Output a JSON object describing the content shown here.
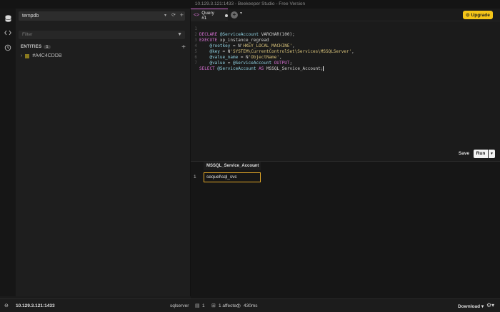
{
  "window": {
    "title": "10.129.3.121:1433 - Beekeeper Studio - Free Version"
  },
  "rail": {
    "icons": [
      "database-icon",
      "code-icon",
      "history-icon"
    ]
  },
  "sidebar": {
    "database": "tempdb",
    "filter_placeholder": "Filter",
    "entities_label": "ENTITIES",
    "entities_count": "1",
    "entity": "#A4C4CDDB"
  },
  "tabs": {
    "active_label": "Query #1"
  },
  "upgrade_label": "Upgrade",
  "editor": {
    "lines": [
      {
        "n": "1"
      },
      {
        "n": "2"
      },
      {
        "n": "3"
      },
      {
        "n": "4"
      },
      {
        "n": "5"
      },
      {
        "n": "6"
      },
      {
        "n": "7"
      }
    ],
    "code": {
      "l1_kw": "DECLARE",
      "l1_var": "@ServiceAccount",
      "l1_rest": "VARCHAR(100);",
      "l2_kw": "EXECUTE",
      "l2_rest": "xp_instance_regread",
      "l3_var": "@rootkey",
      "l3_eq": " = N",
      "l3_str": "'HKEY_LOCAL_MACHINE'",
      "l3_end": ",",
      "l4_var": "@key",
      "l4_eq": " = N",
      "l4_str": "'SYSTEM\\CurrentControlSet\\Services\\MSSQLServer'",
      "l4_end": ",",
      "l5_var": "@value_name",
      "l5_eq": " = N",
      "l5_str": "'ObjectName'",
      "l5_end": ",",
      "l6_var": "@value",
      "l6_eq": " = ",
      "l6_var2": "@ServiceAccount",
      "l6_kw": "OUTPUT",
      "l6_end": ";",
      "l7_kw": "SELECT",
      "l7_var": "@ServiceAccount",
      "l7_kw2": "AS",
      "l7_col": "MSSQL_Service_Account;"
    }
  },
  "actions": {
    "save_label": "Save",
    "run_label": "Run"
  },
  "results": {
    "columns": [
      "MSSQL_Service_Account"
    ],
    "rows": [
      {
        "num": "1",
        "cells": [
          "sequel\\sql_svc"
        ]
      }
    ]
  },
  "status": {
    "connection": "10.129.3.121:1433",
    "dialect": "sqlserver",
    "rows": "1",
    "affected": "1 affected",
    "time": "430ms",
    "download_label": "Download"
  },
  "colors": {
    "accent": "#d46fd1",
    "upgrade": "#f5c518",
    "selected_cell": "#e6a928"
  }
}
